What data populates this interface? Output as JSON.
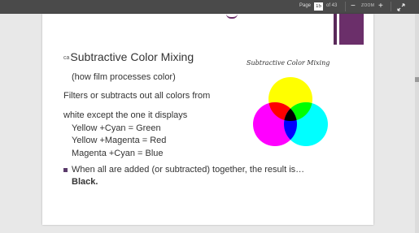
{
  "toolbar": {
    "page_label": "Page",
    "page_current": "15",
    "page_total": "of 43",
    "zoom_out": "−",
    "zoom_label": "ZOOM",
    "zoom_in": "+"
  },
  "slide": {
    "bullet_glyph": "ca",
    "title": "Subtractive Color Mixing",
    "subtitle": "(how film processes color)",
    "line1": "Filters or subtracts out all colors from",
    "line2": "white except the one it displays",
    "equations": [
      "Yellow +Cyan = Green",
      "Yellow +Magenta = Red",
      "Magenta +Cyan = Blue"
    ],
    "final_text": "When all are added (or subtracted) together, the result is…",
    "final_bold": "Black.",
    "figure_title": "Subtractive Color Mixing"
  },
  "colors": {
    "yellow": "#ffff00",
    "magenta": "#ff00ff",
    "cyan": "#00ffff",
    "red": "#ff0000",
    "green": "#00ff00",
    "blue": "#0000ff",
    "black": "#000000",
    "accent": "#6b2f6a"
  }
}
